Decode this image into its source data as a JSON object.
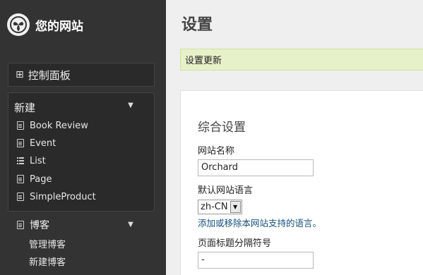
{
  "site": {
    "title": "您的网站",
    "logo_icon": "orchard-logo-icon"
  },
  "sidebar": {
    "dashboard": {
      "label": "控制面板",
      "icon": "grid-icon"
    },
    "new_menu": {
      "label": "新建",
      "items": [
        {
          "label": "Book Review",
          "icon": "document-icon"
        },
        {
          "label": "Event",
          "icon": "document-icon"
        },
        {
          "label": "List",
          "icon": "list-icon"
        },
        {
          "label": "Page",
          "icon": "document-icon"
        },
        {
          "label": "SimpleProduct",
          "icon": "document-icon"
        }
      ]
    },
    "blog_menu": {
      "label": "博客",
      "icon": "document-icon",
      "items": [
        {
          "label": "管理博客"
        },
        {
          "label": "新建博客"
        }
      ]
    }
  },
  "main": {
    "title": "设置",
    "message": "设置更新",
    "section_title": "综合设置",
    "site_name": {
      "label": "网站名称",
      "value": "Orchard"
    },
    "language": {
      "label": "默认网站语言",
      "value": "zh-CN",
      "link": "添加或移除本网站支持的语言。"
    },
    "separator": {
      "label": "页面标题分隔符号",
      "value": "-"
    }
  },
  "colors": {
    "sidebar_bg": "#333333",
    "message_bg": "#e6f1c9",
    "link": "#16507f"
  }
}
